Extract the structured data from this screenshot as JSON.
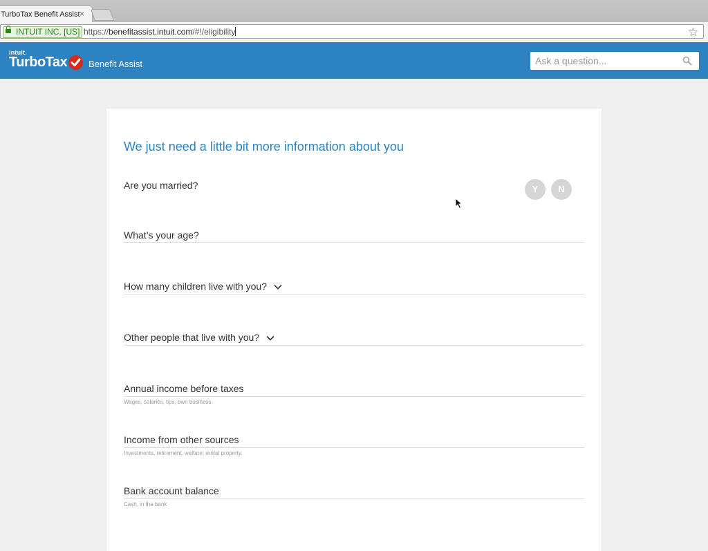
{
  "browser": {
    "tab_title": "TurboTax Benefit Assist",
    "tab_close": "×",
    "ev_cert": "INTUIT INC. [US]",
    "url_scheme": "https://",
    "url_host": "benefitassist.intuit.com",
    "url_path": "/#!/eligibility"
  },
  "header": {
    "brand_parent": "intuit.",
    "brand_name": "TurboTax",
    "product": "Benefit Assist",
    "search_placeholder": "Ask a question...",
    "bg_color": "#2d82c1"
  },
  "form": {
    "title": "We just need a little bit more information about you",
    "married": {
      "label": "Are you married?",
      "yes": "Y",
      "no": "N"
    },
    "age": {
      "label": "What’s your age?"
    },
    "children": {
      "label": "How many children live with you?"
    },
    "others": {
      "label": "Other people that live with you?"
    },
    "income": {
      "label": "Annual income before taxes",
      "help": "Wages, salaries, tips, own business."
    },
    "other_income": {
      "label": "Income from other sources",
      "help": "Investments, retirement, welfare, rental property."
    },
    "bank": {
      "label": "Bank account balance",
      "help": "Cash, in the bank"
    }
  },
  "colors": {
    "accent": "#2d82c1",
    "check": "#d52b1e",
    "ev_green": "#2d8a19"
  }
}
